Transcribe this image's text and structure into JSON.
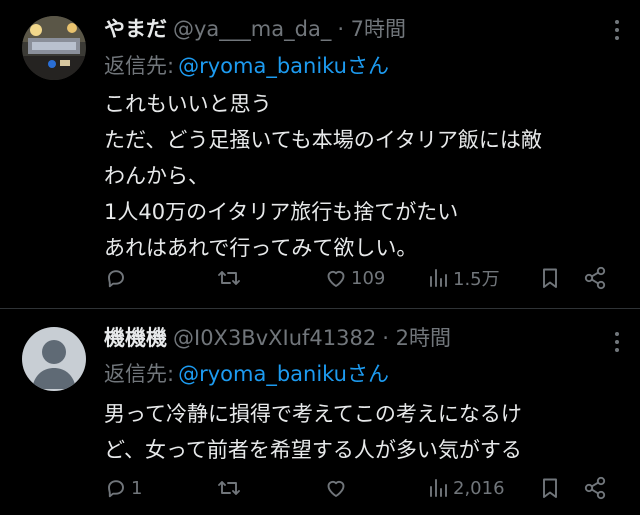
{
  "tweets": [
    {
      "display_name": "やまだ",
      "handle": "@ya___ma_da_",
      "time": "· 7時間",
      "reply_label": "返信先:",
      "reply_to": "@ryoma_banikuさん",
      "text_lines": [
        "これもいいと思う",
        "ただ、どう足掻いても本場のイタリア飯には敵",
        "わんから、",
        "1人40万のイタリア旅行も捨てがたい",
        "あれはあれで行ってみて欲しい。"
      ],
      "replies": "",
      "retweets": "",
      "likes": "109",
      "views": "1.5万"
    },
    {
      "display_name": "機機機",
      "handle": "@I0X3BvXIuf41382",
      "time": "· 2時間",
      "reply_label": "返信先:",
      "reply_to": "@ryoma_banikuさん",
      "text_lines": [
        "男って冷静に損得で考えてこの考えになるけ",
        "ど、女って前者を希望する人が多い気がする"
      ],
      "replies": "1",
      "retweets": "",
      "likes": "",
      "views": "2,016"
    }
  ],
  "icons": {
    "more": "more-vertical-icon",
    "reply": "reply-icon",
    "retweet": "retweet-icon",
    "like": "heart-icon",
    "views": "views-chart-icon",
    "bookmark": "bookmark-icon",
    "share": "share-icon"
  },
  "colors": {
    "background": "#000000",
    "text": "#e7e9ea",
    "muted": "#71767b",
    "link": "#1d9bf0",
    "divider": "#2f3336"
  }
}
